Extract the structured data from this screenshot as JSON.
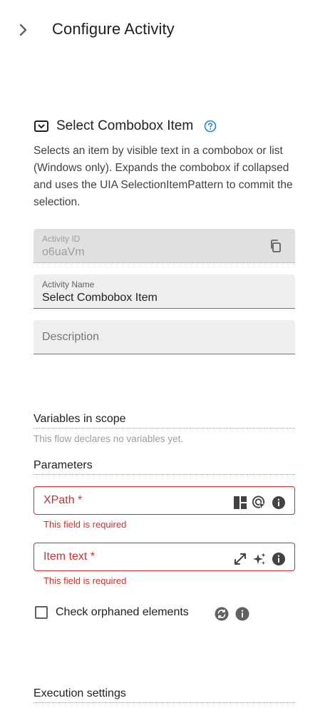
{
  "header": {
    "title": "Configure Activity",
    "collapse_icon": "chevron-right-icon"
  },
  "activity": {
    "type_icon": "combobox-icon",
    "name": "Select Combobox Item",
    "help_icon": "help-circle-icon",
    "description": "Selects an item by visible text in a combobox or list (Windows only). Expands the combobox if collapsed and uses the UIA SelectionItemPattern to commit the selection."
  },
  "fields": {
    "activity_id": {
      "label": "Activity ID",
      "value": "o6uaVm",
      "icon": "copy-icon"
    },
    "activity_name": {
      "label": "Activity Name",
      "value": "Select Combobox Item"
    },
    "description": {
      "placeholder": "Description"
    }
  },
  "variables": {
    "title": "Variables in scope",
    "note": "This flow declares no variables yet."
  },
  "parameters": {
    "title": "Parameters",
    "xpath": {
      "label": "XPath *",
      "error": "This field is required",
      "icons": [
        "layout-icon",
        "target-pick-icon",
        "info-icon"
      ]
    },
    "item_text": {
      "label": "Item text *",
      "error": "This field is required",
      "icons": [
        "expand-icon",
        "sparkle-icon",
        "info-icon"
      ]
    },
    "check_orphaned": {
      "label": "Check orphaned elements",
      "checked": false,
      "icons": [
        "sync-icon",
        "info-icon"
      ]
    }
  },
  "execution": {
    "title": "Execution settings"
  },
  "colors": {
    "error": "#d32f2f",
    "accent": "#1e88e5",
    "text": "#212121",
    "muted": "#9e9e9e"
  }
}
